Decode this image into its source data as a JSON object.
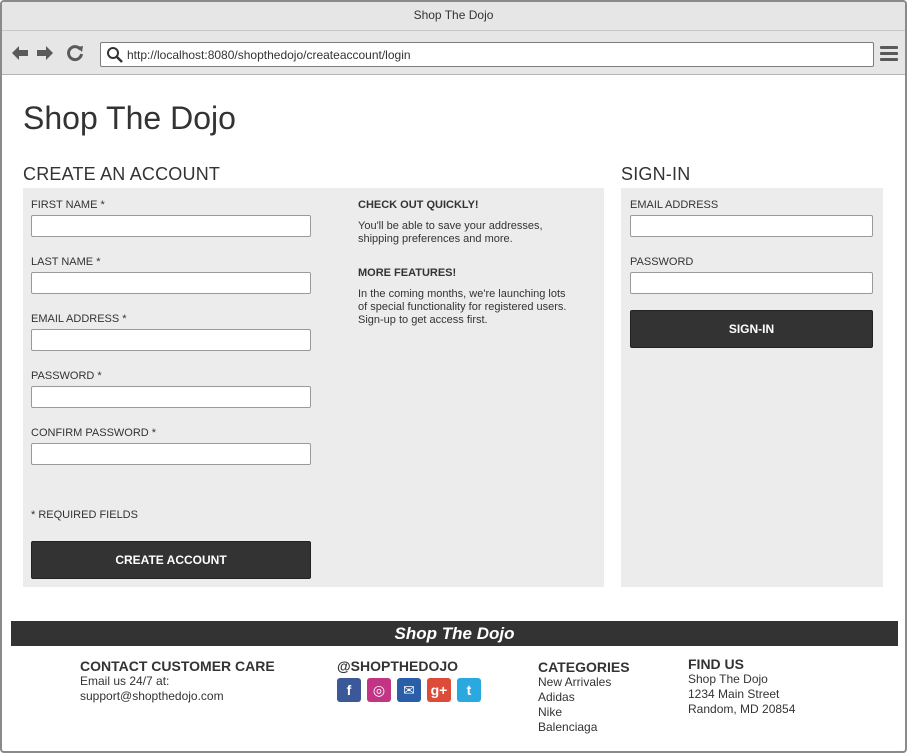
{
  "window": {
    "title": "Shop The Dojo"
  },
  "browser": {
    "url": "http://localhost:8080/shopthedojo/createaccount/login",
    "icons": [
      "back-arrow-icon",
      "forward-arrow-icon",
      "reload-icon",
      "search-icon",
      "hamburger-menu-icon"
    ]
  },
  "page": {
    "brand": "Shop The Dojo"
  },
  "create_account": {
    "title": "CREATE AN ACCOUNT",
    "fields": [
      {
        "label": "FIRST NAME *",
        "value": ""
      },
      {
        "label": "LAST NAME *",
        "value": ""
      },
      {
        "label": "EMAIL ADDRESS *",
        "value": ""
      },
      {
        "label": "PASSWORD *",
        "value": ""
      },
      {
        "label": "CONFIRM PASSWORD *",
        "value": ""
      }
    ],
    "required_note": "* REQUIRED FIELDS",
    "button_label": "CREATE ACCOUNT",
    "info": [
      {
        "title": "CHECK OUT QUICKLY!",
        "lines": [
          "You'll be able to save your addresses,",
          "shipping preferences and more."
        ]
      },
      {
        "title": "MORE FEATURES!",
        "lines": [
          "In the coming months, we're launching lots",
          "of special functionality for registered users.",
          "Sign-up to get access first."
        ]
      }
    ]
  },
  "sign_in": {
    "title": "SIGN-IN",
    "fields": [
      {
        "label": "EMAIL ADDRESS",
        "value": ""
      },
      {
        "label": "PASSWORD",
        "value": ""
      }
    ],
    "button_label": "SIGN-IN"
  },
  "footer": {
    "brand": "Shop The Dojo",
    "contact": {
      "heading": "CONTACT CUSTOMER CARE",
      "lines": [
        "Email us 24/7 at:",
        "support@shopthedojo.com"
      ]
    },
    "social": {
      "heading": "@SHOPTHEDOJO",
      "icons": [
        {
          "name": "facebook-icon",
          "glyph": "f",
          "color": "#3b5998"
        },
        {
          "name": "instagram-icon",
          "glyph": "◎",
          "color": "#c13584"
        },
        {
          "name": "email-icon",
          "glyph": "✉",
          "color": "#2b5ea8"
        },
        {
          "name": "google-plus-icon",
          "glyph": "g+",
          "color": "#dd4b39"
        },
        {
          "name": "twitter-icon",
          "glyph": "t",
          "color": "#2aa9e0"
        }
      ]
    },
    "categories": {
      "heading": "CATEGORIES",
      "items": [
        "New Arrivales",
        "Adidas",
        "Nike",
        "Balenciaga"
      ]
    },
    "find_us": {
      "heading": "FIND US",
      "lines": [
        "Shop The Dojo",
        "1234 Main Street",
        "Random, MD 20854"
      ]
    }
  },
  "colors": {
    "dark": "#333333",
    "panel": "#ececec",
    "chrome": "#e6e6e6"
  }
}
